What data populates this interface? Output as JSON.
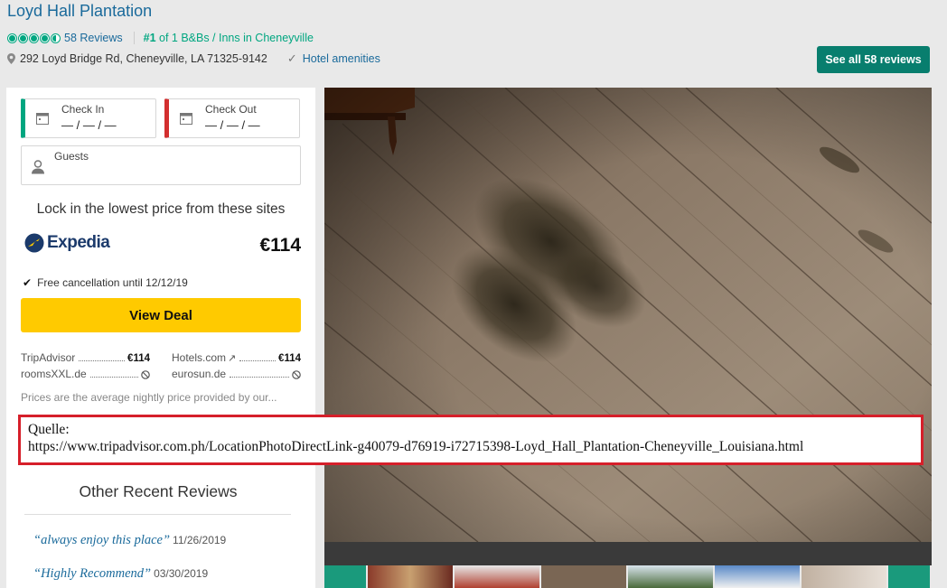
{
  "header": {
    "title": "Loyd Hall Plantation",
    "reviews_link": "58 Reviews",
    "rank_prefix": "#1",
    "rank_text": " of 1 B&Bs / Inns in Cheneyville",
    "address": "292 Loyd Bridge Rd, Cheneyville, LA 71325-9142",
    "amenities_link": "Hotel amenities",
    "see_all_button": "See all 58 reviews"
  },
  "booking": {
    "check_in_label": "Check In",
    "check_in_value": "— / — / —",
    "check_out_label": "Check Out",
    "check_out_value": "— / — / —",
    "guests_label": "Guests",
    "lock_title": "Lock in the lowest price from these sites",
    "featured_provider": "Expedia",
    "featured_price": "€114",
    "free_cancellation": "Free cancellation until 12/12/19",
    "view_deal_button": "View Deal",
    "providers": [
      {
        "name": "TripAdvisor",
        "price": "€114"
      },
      {
        "name": "Hotels.com",
        "price": "€114"
      },
      {
        "name": "roomsXXL.de",
        "price": ""
      },
      {
        "name": "eurosun.de",
        "price": ""
      }
    ],
    "prices_note": "Prices are the average nightly price provided by our..."
  },
  "source": {
    "label": "Quelle:",
    "url": "https://www.tripadvisor.com.ph/LocationPhotoDirectLink-g40079-d76919-i72715398-Loyd_Hall_Plantation-Cheneyville_Louisiana.html"
  },
  "other_reviews": {
    "title": "Other Recent Reviews",
    "items": [
      {
        "quote": "“always enjoy this place”",
        "date": "11/26/2019"
      },
      {
        "quote": "“Highly Recommend”",
        "date": "03/30/2019"
      }
    ]
  },
  "rating": {
    "bubbles": 4.5,
    "color": "#00a680"
  },
  "colors": {
    "link": "#1a6a9b",
    "accent_green": "#00a680",
    "button_green": "#087e6e",
    "deal_yellow": "#ffca00",
    "checkout_red": "#d32f2f",
    "highlight_red": "#d61f2a"
  }
}
